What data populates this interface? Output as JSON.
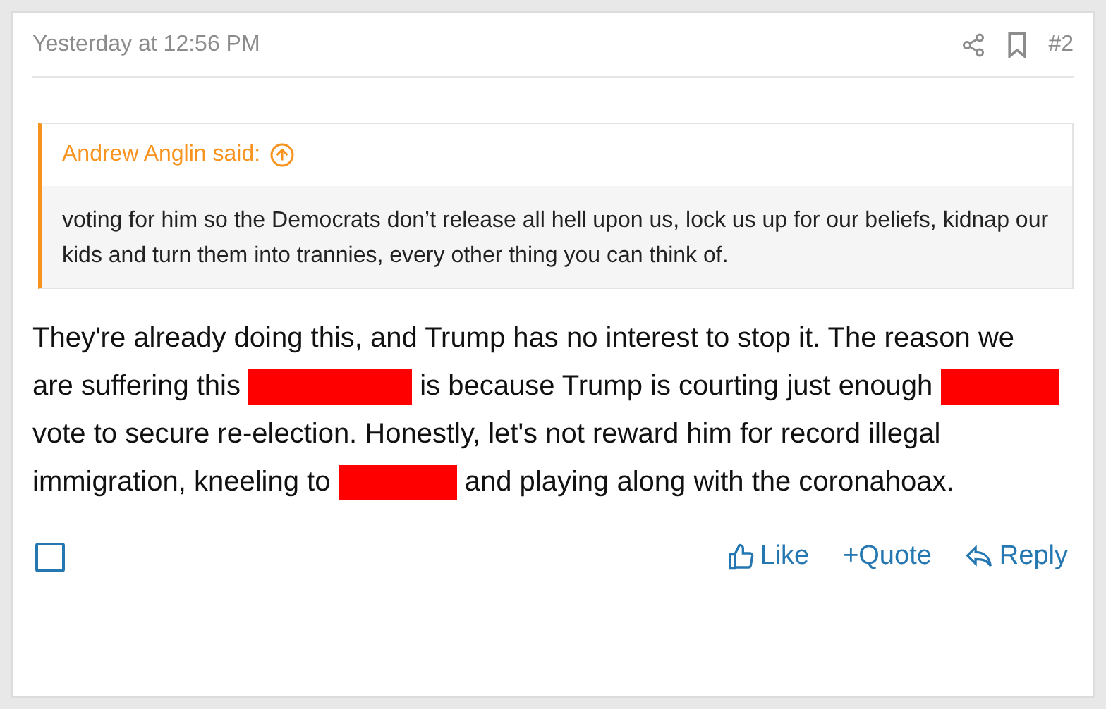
{
  "post": {
    "timestamp": "Yesterday at 12:56 PM",
    "number": "#2",
    "quote": {
      "author": "Andrew Anglin said:",
      "text": "voting for him so the Democrats don’t release all hell upon us, lock us up for our beliefs, kidnap our kids and turn them into trannies, every other thing you can think of."
    },
    "body": [
      {
        "kind": "text",
        "text": "They're already doing this, and Trump has no interest to stop it. The reason we are suffering this"
      },
      {
        "kind": "redaction"
      },
      {
        "kind": "text",
        "text": "is because Trump is courting just enough"
      },
      {
        "kind": "redaction"
      },
      {
        "kind": "text",
        "text": "vote to secure re-election. Honestly, let's not reward him for record illegal immigration, kneeling to"
      },
      {
        "kind": "redaction"
      },
      {
        "kind": "text",
        "text": "and playing along with the coronahoax."
      }
    ],
    "actions": {
      "selected": false,
      "like": "Like",
      "quote": "+Quote",
      "reply": "Reply"
    }
  }
}
